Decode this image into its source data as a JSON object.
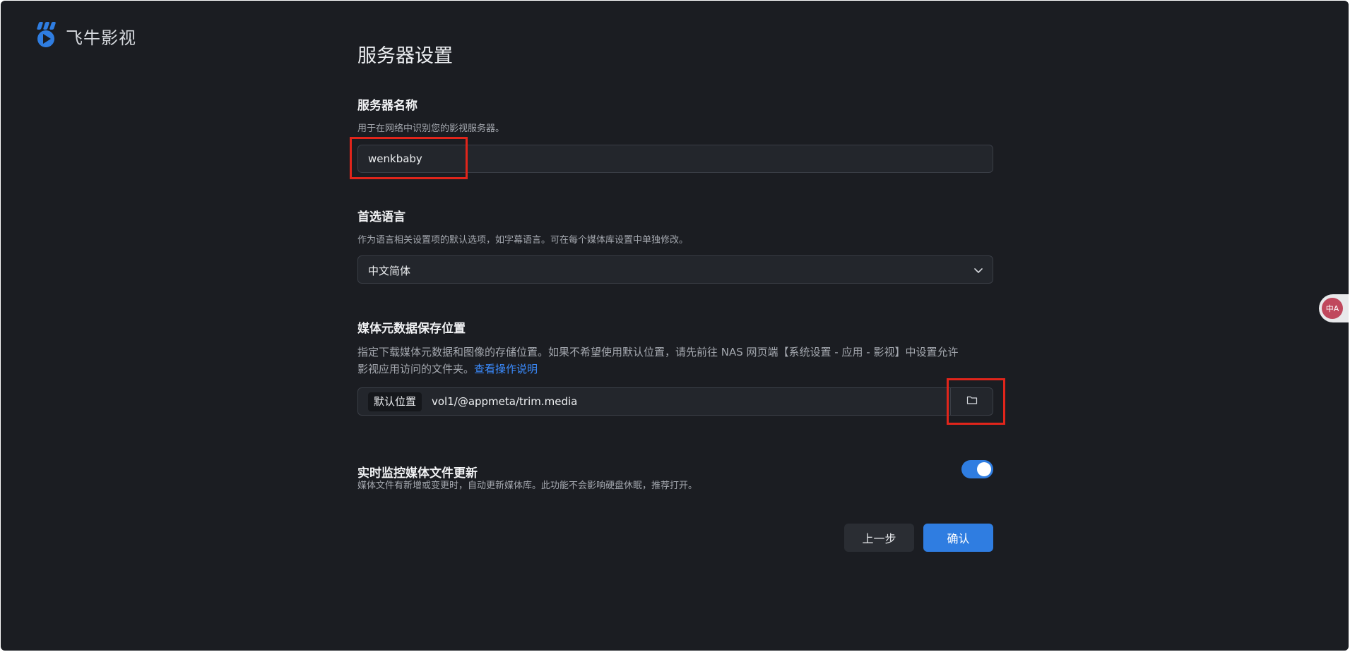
{
  "app": {
    "name": "飞牛影视",
    "brand_color": "#2f7de1"
  },
  "page": {
    "title": "服务器设置"
  },
  "server_name": {
    "title": "服务器名称",
    "description": "用于在网络中识别您的影视服务器。",
    "value": "wenkbaby"
  },
  "language": {
    "title": "首选语言",
    "description": "作为语言相关设置项的默认选项，如字幕语言。可在每个媒体库设置中单独修改。",
    "selected": "中文简体"
  },
  "metadata_location": {
    "title": "媒体元数据保存位置",
    "description_line1": "指定下载媒体元数据和图像的存储位置。如果不希望使用默认位置，请先前往 NAS 网页端【系统设置 - 应用 - 影视】中设置允许",
    "description_line2": "影视应用访问的文件夹。",
    "help_link": "查看操作说明",
    "tag": "默认位置",
    "path": "vol1/@appmeta/trim.media",
    "browse_icon": "folder-icon"
  },
  "realtime_monitor": {
    "title": "实时监控媒体文件更新",
    "description": "媒体文件有新增或变更时，自动更新媒体库。此功能不会影响硬盘休眠，推荐打开。",
    "enabled": true
  },
  "actions": {
    "prev_label": "上一步",
    "confirm_label": "确认"
  },
  "translate_widget": {
    "label": "中A"
  },
  "annotation_color": "#e1251b"
}
